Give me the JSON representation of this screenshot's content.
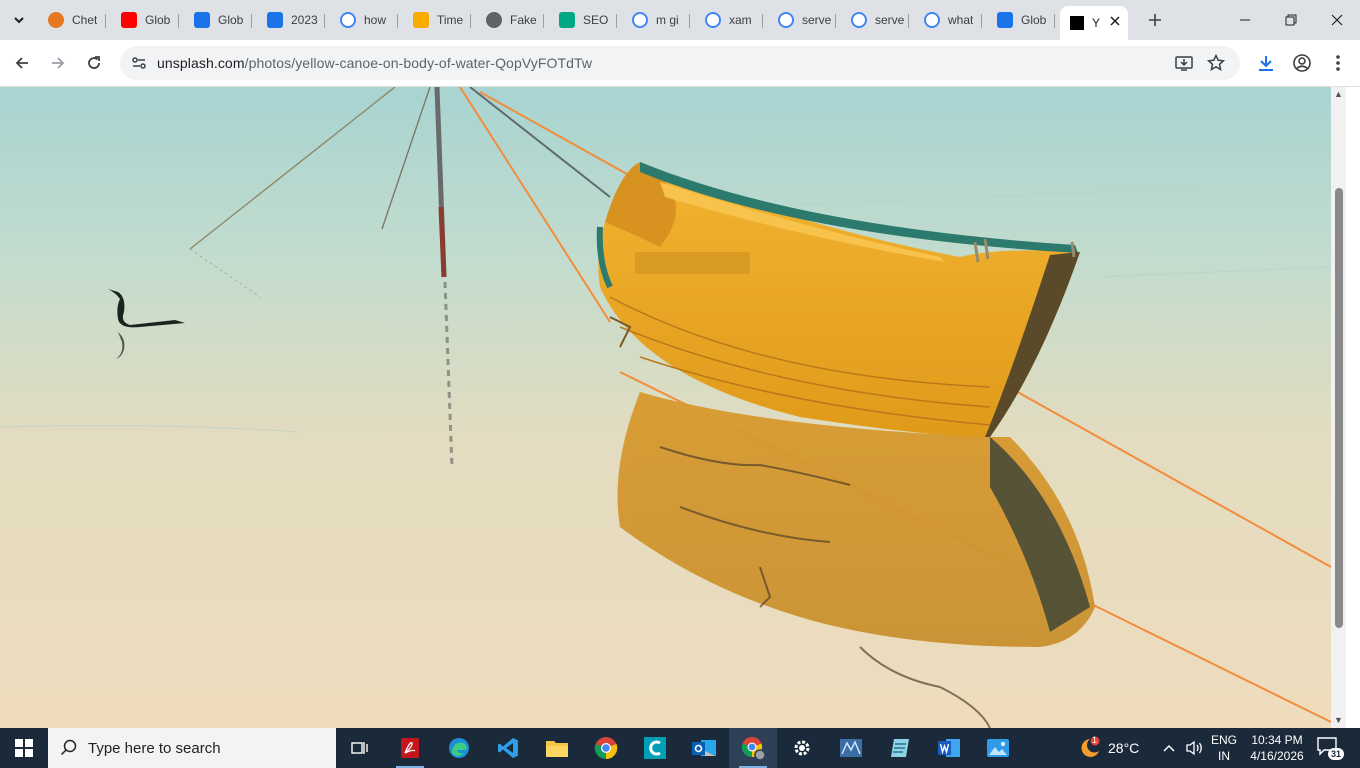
{
  "browser": {
    "tabs": [
      {
        "title": "Chet",
        "icon": "chegg-icon",
        "color": "#e87722"
      },
      {
        "title": "Glob",
        "icon": "youtube-icon",
        "color": "#ff0000"
      },
      {
        "title": "Glob",
        "icon": "ship-icon",
        "color": "#1a73e8"
      },
      {
        "title": "2023",
        "icon": "ship-icon",
        "color": "#1a73e8"
      },
      {
        "title": "how",
        "icon": "google-icon",
        "color": "#4285f4"
      },
      {
        "title": "Time",
        "icon": "calendar-icon",
        "color": "#f9ab00"
      },
      {
        "title": "Fake",
        "icon": "fake-icon",
        "color": "#5f6368"
      },
      {
        "title": "SEO",
        "icon": "seo-icon",
        "color": "#00a884"
      },
      {
        "title": "m gi",
        "icon": "google-icon",
        "color": "#4285f4"
      },
      {
        "title": "xam",
        "icon": "google-icon",
        "color": "#4285f4"
      },
      {
        "title": "serve",
        "icon": "google-icon",
        "color": "#4285f4"
      },
      {
        "title": "serve",
        "icon": "google-icon",
        "color": "#4285f4"
      },
      {
        "title": "what",
        "icon": "google-icon",
        "color": "#4285f4"
      },
      {
        "title": "Glob",
        "icon": "ship-icon",
        "color": "#1a73e8"
      },
      {
        "title": "Y",
        "icon": "unsplash-icon",
        "color": "#000000",
        "active": true
      }
    ],
    "url_host": "unsplash.com",
    "url_path": "/photos/yellow-canoe-on-body-of-water-QopVyFOTdTw"
  },
  "taskbar": {
    "search_placeholder": "Type here to search",
    "weather": "28°C",
    "weather_badge": "1",
    "lang_line1": "ENG",
    "lang_line2": "IN",
    "time": "10:34 PM",
    "date": "4/16/2026",
    "notification_count": "31"
  }
}
